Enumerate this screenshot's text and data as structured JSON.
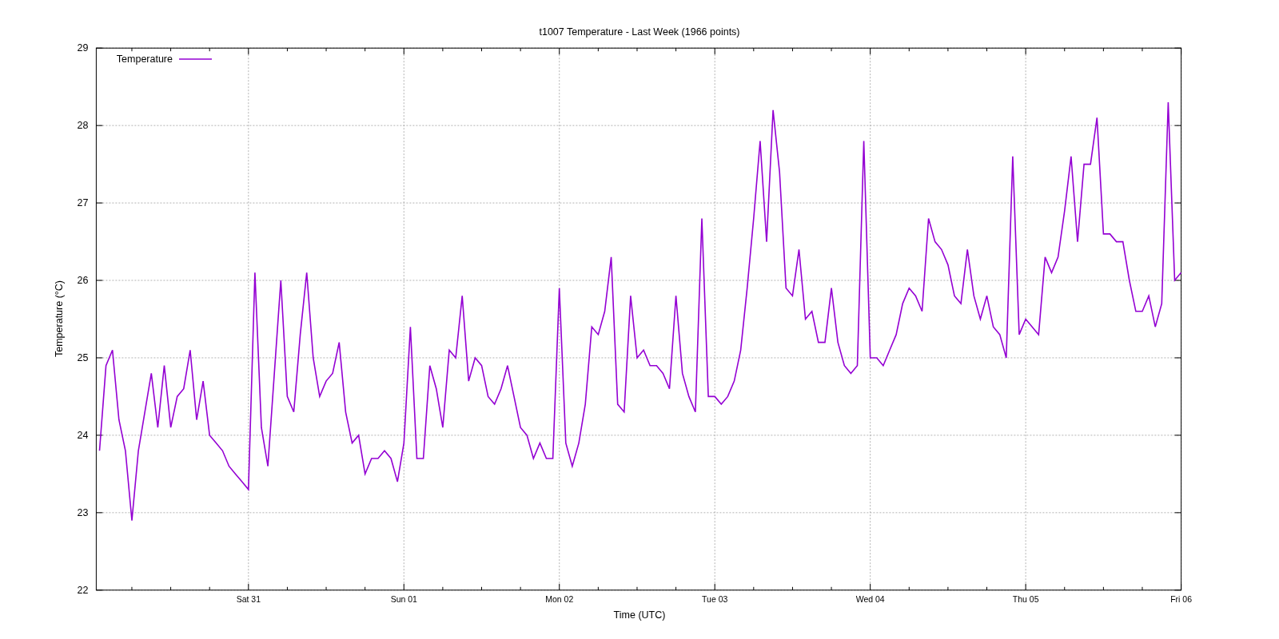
{
  "chart": {
    "chart_data": {
      "type": "line",
      "title": "t1007 Temperature - Last Week (1966 points)",
      "xlabel": "Time (UTC)",
      "ylabel": "Temperature (°C)",
      "categories": [
        null,
        null,
        null,
        null,
        null,
        null,
        null,
        null,
        null,
        null,
        null,
        null,
        null,
        null,
        null,
        null,
        null,
        null,
        null,
        null,
        null,
        null,
        null,
        "Sat 31",
        null,
        null,
        null,
        null,
        null,
        null,
        null,
        null,
        null,
        null,
        null,
        null,
        null,
        null,
        null,
        null,
        null,
        null,
        null,
        null,
        null,
        null,
        null,
        "Sun 01",
        null,
        null,
        null,
        null,
        null,
        null,
        null,
        null,
        null,
        null,
        null,
        null,
        null,
        null,
        null,
        null,
        null,
        null,
        null,
        null,
        null,
        null,
        null,
        "Mon 02",
        null,
        null,
        null,
        null,
        null,
        null,
        null,
        null,
        null,
        null,
        null,
        null,
        null,
        null,
        null,
        null,
        null,
        null,
        null,
        null,
        null,
        null,
        null,
        "Tue 03",
        null,
        null,
        null,
        null,
        null,
        null,
        null,
        null,
        null,
        null,
        null,
        null,
        null,
        null,
        null,
        null,
        null,
        null,
        null,
        null,
        null,
        null,
        null,
        "Wed 04",
        null,
        null,
        null,
        null,
        null,
        null,
        null,
        null,
        null,
        null,
        null,
        null,
        null,
        null,
        null,
        null,
        null,
        null,
        null,
        null,
        null,
        null,
        null,
        "Thu 05",
        null,
        null,
        null,
        null,
        null,
        null,
        null,
        null,
        null,
        null,
        null,
        null,
        null,
        null,
        null,
        null,
        null,
        null,
        null,
        null,
        null,
        null,
        null,
        "Fri 06"
      ],
      "series": [
        {
          "name": "Temperature",
          "color": "#9400d3",
          "values": [
            23.8,
            24.9,
            25.1,
            24.2,
            23.8,
            22.9,
            23.8,
            24.3,
            24.8,
            24.1,
            24.9,
            24.1,
            24.5,
            24.6,
            25.1,
            24.2,
            24.7,
            24.0,
            23.9,
            23.8,
            23.6,
            23.5,
            23.4,
            23.3,
            26.1,
            24.1,
            23.6,
            24.8,
            26.0,
            24.5,
            24.3,
            25.3,
            26.1,
            25.0,
            24.5,
            24.7,
            24.8,
            25.2,
            24.3,
            23.9,
            24.0,
            23.5,
            23.7,
            23.7,
            23.8,
            23.7,
            23.4,
            23.9,
            25.4,
            23.7,
            23.7,
            24.9,
            24.6,
            24.1,
            25.1,
            25.0,
            25.8,
            24.7,
            25.0,
            24.9,
            24.5,
            24.4,
            24.6,
            24.9,
            24.5,
            24.1,
            24.0,
            23.7,
            23.9,
            23.7,
            23.7,
            25.9,
            23.9,
            23.6,
            23.9,
            24.4,
            25.4,
            25.3,
            25.6,
            26.3,
            24.4,
            24.3,
            25.8,
            25.0,
            25.1,
            24.9,
            24.9,
            24.8,
            24.6,
            25.8,
            24.8,
            24.5,
            24.3,
            26.8,
            24.5,
            24.5,
            24.4,
            24.5,
            24.7,
            25.1,
            25.9,
            26.8,
            27.8,
            26.5,
            28.2,
            27.4,
            25.9,
            25.8,
            26.4,
            25.5,
            25.6,
            25.2,
            25.2,
            25.9,
            25.2,
            24.9,
            24.8,
            24.9,
            27.8,
            25.0,
            25.0,
            24.9,
            25.1,
            25.3,
            25.7,
            25.9,
            25.8,
            25.6,
            26.8,
            26.5,
            26.4,
            26.2,
            25.8,
            25.7,
            26.4,
            25.8,
            25.5,
            25.8,
            25.4,
            25.3,
            25.0,
            27.6,
            25.3,
            25.5,
            25.4,
            25.3,
            26.3,
            26.1,
            26.3,
            26.9,
            27.6,
            26.5,
            27.5,
            27.5,
            28.1,
            26.6,
            26.6,
            26.5,
            26.5,
            26.0,
            25.6,
            25.6,
            25.8,
            25.4,
            25.7,
            28.3,
            26.0,
            26.1
          ]
        }
      ],
      "ylim": [
        22,
        29
      ],
      "grid": true,
      "yticks": [
        22,
        23,
        24,
        25,
        26,
        27,
        28,
        29
      ]
    }
  }
}
